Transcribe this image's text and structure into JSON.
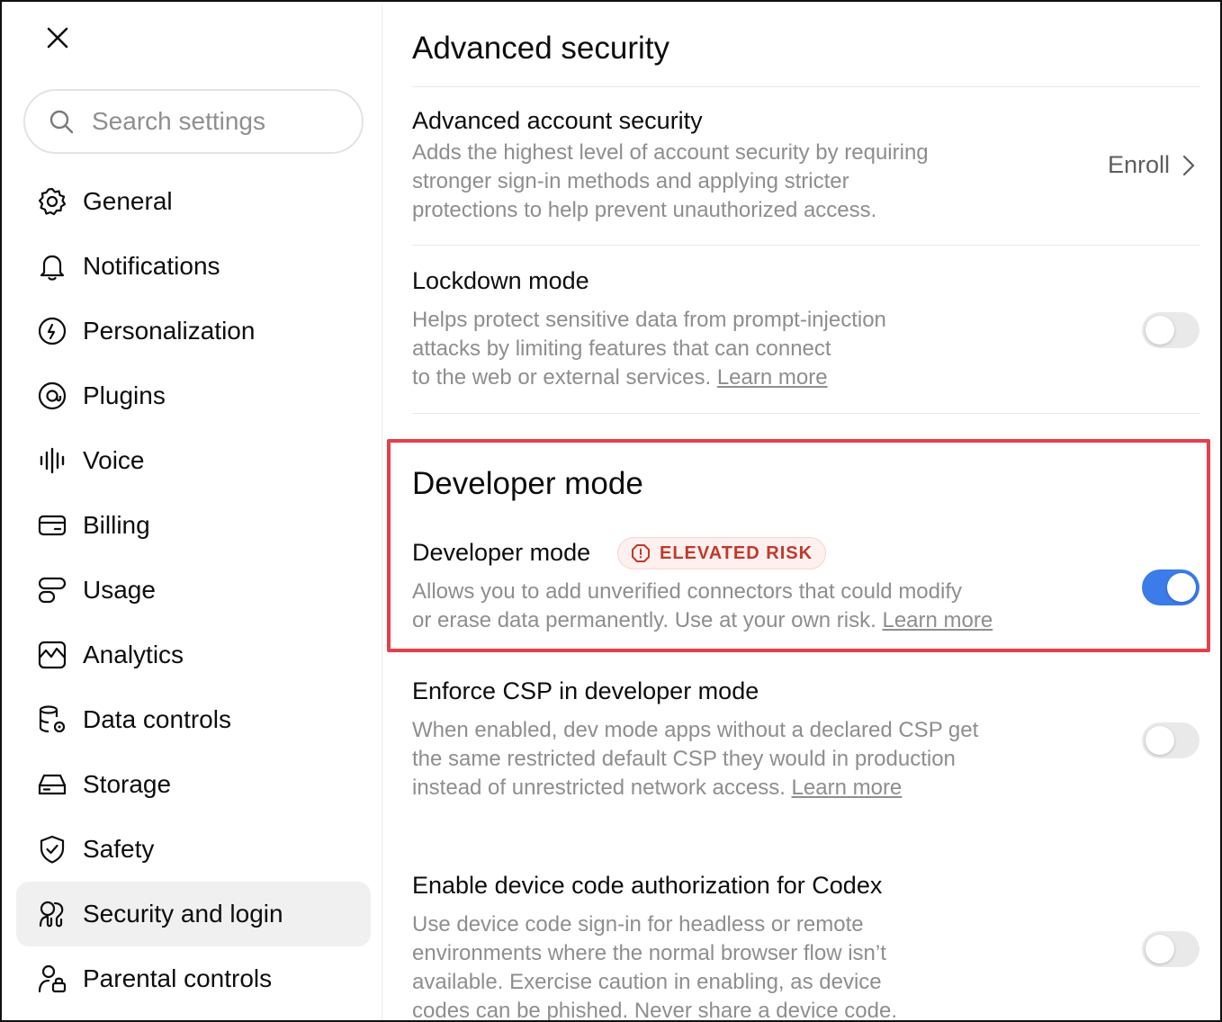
{
  "sidebar": {
    "search_placeholder": "Search settings",
    "items": [
      {
        "label": "General",
        "icon": "gear-icon"
      },
      {
        "label": "Notifications",
        "icon": "bell-icon"
      },
      {
        "label": "Personalization",
        "icon": "personalization-icon"
      },
      {
        "label": "Plugins",
        "icon": "plugins-icon"
      },
      {
        "label": "Voice",
        "icon": "voice-waveform-icon"
      },
      {
        "label": "Billing",
        "icon": "card-icon"
      },
      {
        "label": "Usage",
        "icon": "usage-icon"
      },
      {
        "label": "Analytics",
        "icon": "analytics-chart-icon"
      },
      {
        "label": "Data controls",
        "icon": "database-gear-icon"
      },
      {
        "label": "Storage",
        "icon": "storage-drive-icon"
      },
      {
        "label": "Safety",
        "icon": "shield-check-icon"
      },
      {
        "label": "Security and login",
        "icon": "security-users-icon",
        "active": true
      },
      {
        "label": "Parental controls",
        "icon": "parental-lock-icon"
      }
    ]
  },
  "main": {
    "section_title": "Advanced security",
    "advanced_account": {
      "title": "Advanced account security",
      "desc_line1": "Adds the highest level of account security by requiring",
      "desc_line2": "stronger sign-in methods and applying stricter",
      "desc_line3": "protections to help prevent unauthorized access.",
      "action_label": "Enroll"
    },
    "lockdown": {
      "title": "Lockdown mode",
      "desc_line1": "Helps protect sensitive data from prompt-injection",
      "desc_line2": "attacks by limiting features that can connect",
      "desc_line3": "to the web or external services.",
      "learn_more": "Learn more",
      "enabled": false
    },
    "developer_section_title": "Developer mode",
    "developer": {
      "title": "Developer mode",
      "badge": "ELEVATED RISK",
      "desc_line1": "Allows you to add unverified connectors that could modify",
      "desc_line2": "or erase data permanently. Use at your own risk.",
      "learn_more": "Learn more",
      "enabled": true
    },
    "csp": {
      "title": "Enforce CSP in developer mode",
      "desc_line1": "When enabled, dev mode apps without a declared CSP get",
      "desc_line2": "the same restricted default CSP they would in production",
      "desc_line3": "instead of unrestricted network access.",
      "learn_more": "Learn more",
      "enabled": false
    },
    "device_code": {
      "title": "Enable device code authorization for Codex",
      "desc_line1": "Use device code sign-in for headless or remote",
      "desc_line2": "environments where the normal browser flow isn’t",
      "desc_line3": "available. Exercise caution in enabling, as device",
      "desc_line4": "codes can be phished. Never share a device code.",
      "enabled": false
    }
  },
  "colors": {
    "accent": "#3b7bea",
    "risk_text": "#c0392b",
    "risk_bg": "#fdf0ee",
    "highlight_border": "#e5404a",
    "muted_text": "#8e8e8e"
  }
}
